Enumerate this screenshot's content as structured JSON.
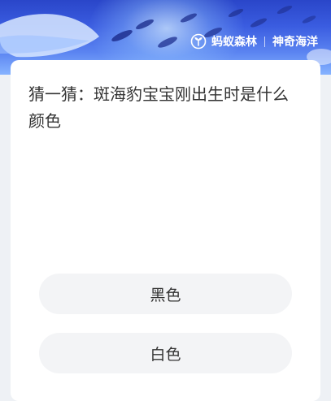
{
  "header": {
    "brand_name": "蚂蚁森林",
    "section_name": "神奇海洋",
    "logo_icon": "ant-forest-leaf-icon"
  },
  "quiz": {
    "question": "猜一猜：斑海豹宝宝刚出生时是什么颜色",
    "options": [
      {
        "label": "黑色"
      },
      {
        "label": "白色"
      }
    ]
  },
  "colors": {
    "banner_top": "#2a46c9",
    "banner_bottom": "#86b3ff",
    "option_bg": "#f3f4f6",
    "text": "#333333"
  }
}
